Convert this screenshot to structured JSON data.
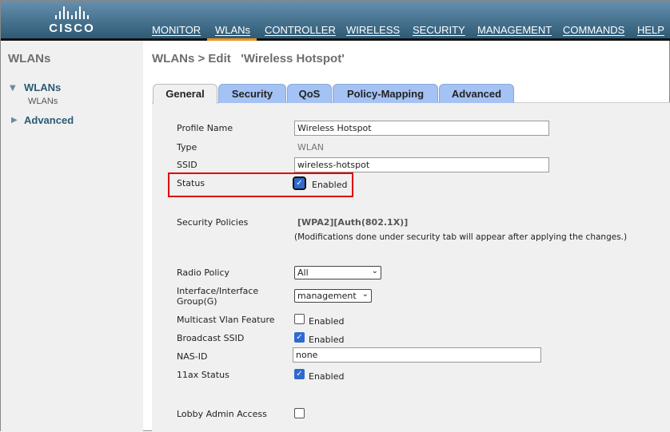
{
  "header": {
    "logo": "CISCO",
    "nav": [
      "MONITOR",
      "WLANs",
      "CONTROLLER",
      "WIRELESS",
      "SECURITY",
      "MANAGEMENT",
      "COMMANDS",
      "HELP"
    ],
    "active_nav": "WLANs"
  },
  "sidebar": {
    "title": "WLANs",
    "items": [
      {
        "label": "WLANs",
        "expanded": true,
        "sub": [
          "WLANs"
        ]
      },
      {
        "label": "Advanced",
        "expanded": false
      }
    ]
  },
  "page": {
    "title": "WLANs > Edit   'Wireless Hotspot'"
  },
  "tabs": [
    "General",
    "Security",
    "QoS",
    "Policy-Mapping",
    "Advanced"
  ],
  "form": {
    "profile_name": {
      "label": "Profile Name",
      "value": "Wireless Hotspot"
    },
    "type": {
      "label": "Type",
      "value": "WLAN"
    },
    "ssid": {
      "label": "SSID",
      "value": "wireless-hotspot"
    },
    "status": {
      "label": "Status",
      "checked": true,
      "text": "Enabled"
    },
    "security_policies": {
      "label": "Security Policies",
      "value": "[WPA2][Auth(802.1X)]",
      "note": "(Modifications done under security tab will appear after applying the changes.)"
    },
    "radio_policy": {
      "label": "Radio Policy",
      "value": "All"
    },
    "interface": {
      "label1": "Interface/Interface",
      "label2": "Group(G)",
      "value": "management"
    },
    "multicast": {
      "label": "Multicast Vlan Feature",
      "checked": false,
      "text": "Enabled"
    },
    "broadcast": {
      "label": "Broadcast SSID",
      "checked": true,
      "text": "Enabled"
    },
    "nas_id": {
      "label": "NAS-ID",
      "value": "none"
    },
    "ax_status": {
      "label": "11ax Status",
      "checked": true,
      "text": "Enabled"
    },
    "lobby": {
      "label": "Lobby Admin Access",
      "checked": false
    }
  }
}
